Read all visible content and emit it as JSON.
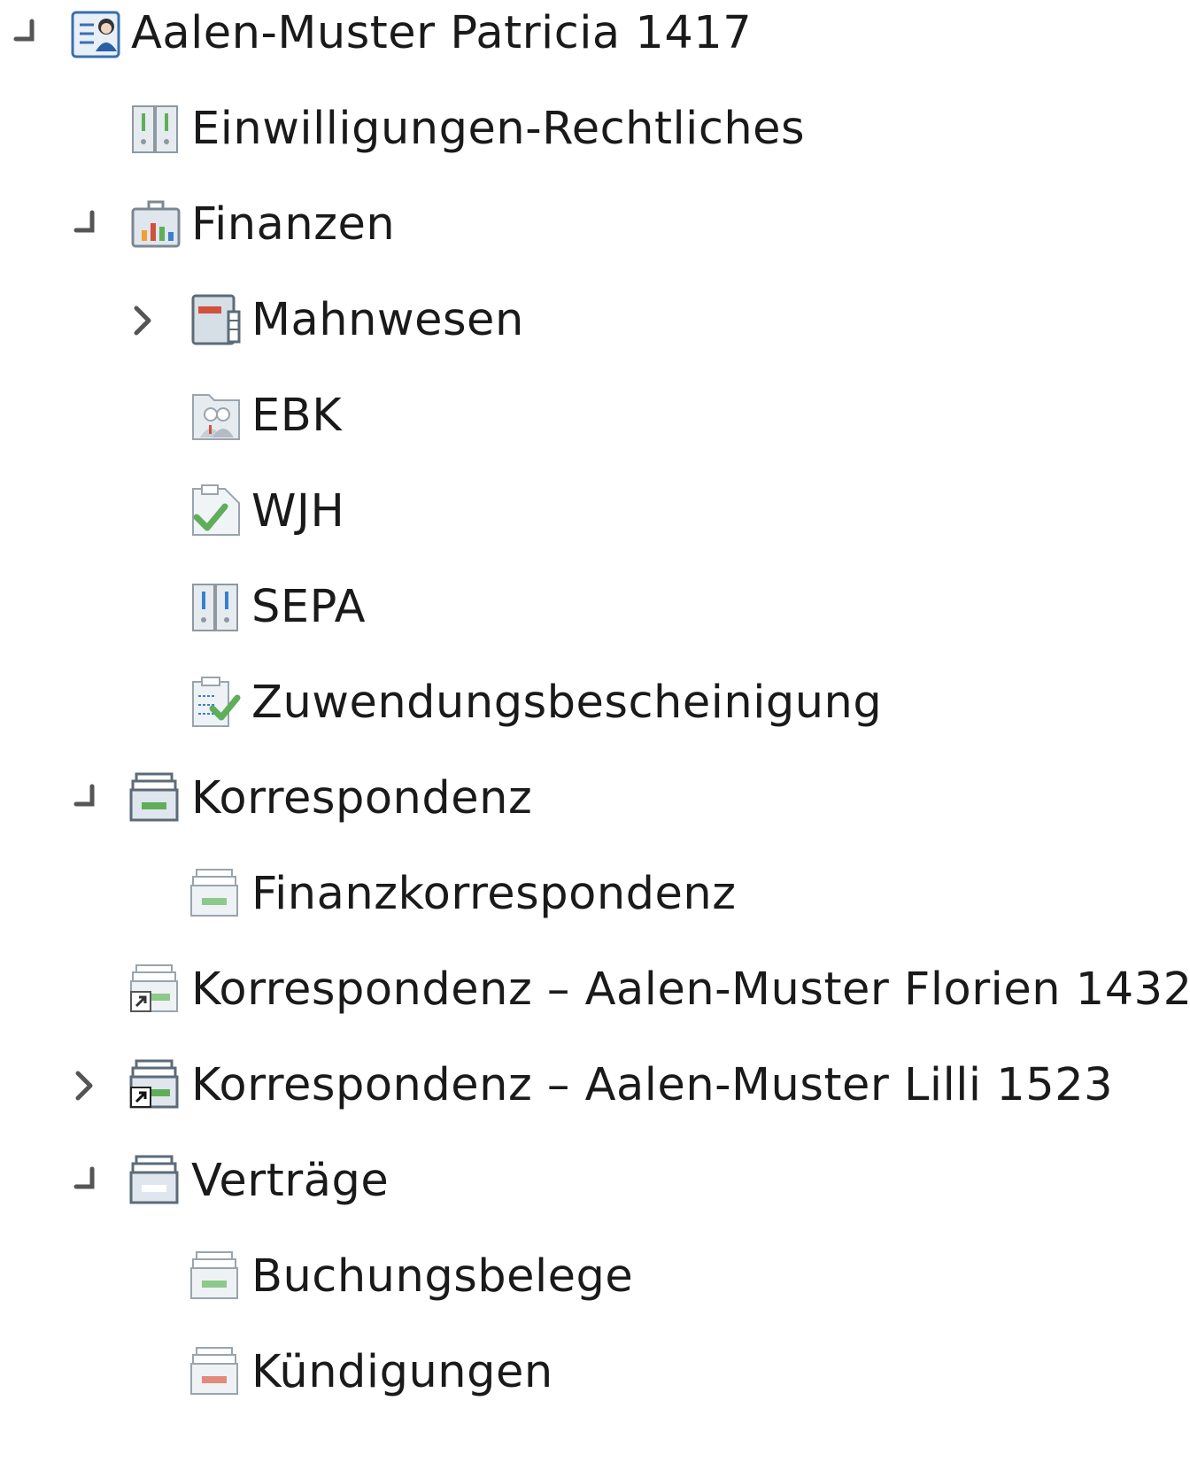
{
  "tree": [
    {
      "label": "Aalen-Muster Patricia 1417",
      "icon": "person-record-icon",
      "toggle": "expanded",
      "depth": 0
    },
    {
      "label": "Einwilligungen-Rechtliches",
      "icon": "binder-icon",
      "toggle": "none",
      "depth": 1
    },
    {
      "label": "Finanzen",
      "icon": "finance-briefcase-icon",
      "toggle": "expanded",
      "depth": 1
    },
    {
      "label": "Mahnwesen",
      "icon": "dunning-folder-icon",
      "toggle": "collapsed",
      "depth": 2
    },
    {
      "label": "EBK",
      "icon": "group-folder-icon",
      "toggle": "none",
      "depth": 2
    },
    {
      "label": "WJH",
      "icon": "check-document-icon",
      "toggle": "none",
      "depth": 2
    },
    {
      "label": "SEPA",
      "icon": "binder-icon",
      "toggle": "none",
      "depth": 2
    },
    {
      "label": "Zuwendungsbescheinigung",
      "icon": "checklist-icon",
      "toggle": "none",
      "depth": 2
    },
    {
      "label": "Korrespondenz",
      "icon": "file-box-icon",
      "toggle": "expanded",
      "depth": 1
    },
    {
      "label": "Finanzkorrespondenz",
      "icon": "file-box-icon",
      "toggle": "none",
      "depth": 2
    },
    {
      "label": "Korrespondenz – Aalen-Muster Florien 1432",
      "icon": "file-box-link-icon",
      "toggle": "none",
      "depth": 1
    },
    {
      "label": "Korrespondenz – Aalen-Muster Lilli 1523",
      "icon": "file-box-link-icon",
      "toggle": "collapsed",
      "depth": 1
    },
    {
      "label": "Verträge",
      "icon": "file-box-icon",
      "toggle": "expanded",
      "depth": 1
    },
    {
      "label": "Buchungsbelege",
      "icon": "file-box-icon",
      "toggle": "none",
      "depth": 2
    },
    {
      "label": "Kündigungen",
      "icon": "file-box-icon",
      "toggle": "none",
      "depth": 2
    }
  ],
  "colors": {
    "text": "#1a1a1a",
    "toggle": "#555555",
    "icon_frame": "#7b8793",
    "icon_fill": "#dfe6ed",
    "green": "#5fae5a",
    "red": "#d0513c",
    "blue": "#3a7fd0"
  }
}
